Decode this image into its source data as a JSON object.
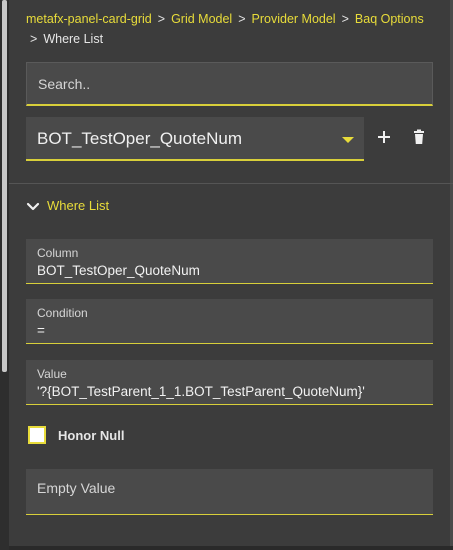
{
  "breadcrumb": {
    "items": [
      {
        "label": "metafx-panel-card-grid"
      },
      {
        "label": "Grid Model"
      },
      {
        "label": "Provider Model"
      },
      {
        "label": "Baq Options"
      }
    ],
    "separator": ">",
    "current": "Where List"
  },
  "search": {
    "placeholder": "Search.."
  },
  "selector": {
    "selected": "BOT_TestOper_QuoteNum",
    "add_icon": "plus-icon",
    "delete_icon": "trash-icon"
  },
  "section": {
    "title": "Where List",
    "expanded": true,
    "icon": "chevron-down-icon"
  },
  "fields": {
    "column": {
      "label": "Column",
      "value": "BOT_TestOper_QuoteNum"
    },
    "condition": {
      "label": "Condition",
      "value": "="
    },
    "value": {
      "label": "Value",
      "value": "'?{BOT_TestParent_1_1.BOT_TestParent_QuoteNum}'"
    },
    "empty_value": {
      "placeholder": "Empty Value",
      "value": ""
    }
  },
  "honor_null": {
    "label": "Honor Null",
    "checked": false
  },
  "colors": {
    "accent": "#e8dc3a",
    "background": "#3c3c3c",
    "field": "#4a4a4a",
    "text": "#e6e6e6"
  }
}
